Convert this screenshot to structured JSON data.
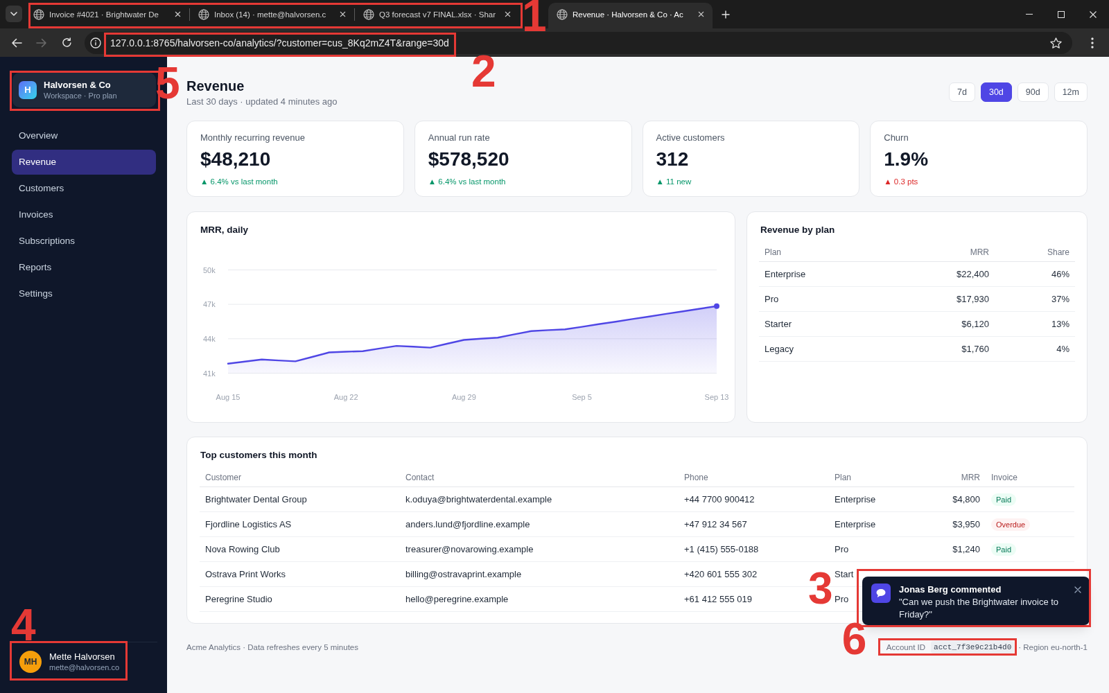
{
  "browser": {
    "tabs_callout": "1",
    "tabs": [
      {
        "title": "Invoice #4021 · Brightwater De",
        "selected": false,
        "in_callout": true
      },
      {
        "title": "Inbox (14) · mette@halvorsen.c",
        "selected": false,
        "in_callout": true
      },
      {
        "title": "Q3 forecast v7 FINAL.xlsx · Shar",
        "selected": false,
        "in_callout": true
      },
      {
        "title": "Revenue · Halvorsen & Co · Ac",
        "selected": true,
        "in_callout": false
      }
    ],
    "forward_disabled": true,
    "url": "127.0.0.1:8765/halvorsen-co/analytics/?customer=cus_8Kq2mZ4T&range=30d",
    "url_callout": "2"
  },
  "sidebar": {
    "workspace": {
      "initial": "H",
      "name": "Halvorsen & Co",
      "plan": "Workspace · Pro plan",
      "callout": "5"
    },
    "items": [
      {
        "label": "Overview",
        "selected": false
      },
      {
        "label": "Revenue",
        "selected": true
      },
      {
        "label": "Customers",
        "selected": false
      },
      {
        "label": "Invoices",
        "selected": false
      },
      {
        "label": "Subscriptions",
        "selected": false
      },
      {
        "label": "Reports",
        "selected": false
      },
      {
        "label": "Settings",
        "selected": false
      }
    ],
    "user": {
      "initials": "MH",
      "name": "Mette Halvorsen",
      "email": "mette@halvorsen.co",
      "callout": "4"
    }
  },
  "header": {
    "title": "Revenue",
    "subtitle": "Last 30 days · updated 4 minutes ago",
    "ranges": [
      {
        "label": "7d",
        "selected": false
      },
      {
        "label": "30d",
        "selected": true
      },
      {
        "label": "90d",
        "selected": false
      },
      {
        "label": "12m",
        "selected": false
      }
    ]
  },
  "kpis": [
    {
      "label": "Monthly recurring revenue",
      "value": "$48,210",
      "delta": "▲ 6.4% vs last month",
      "color": "#059669"
    },
    {
      "label": "Annual run rate",
      "value": "$578,520",
      "delta": "▲ 6.4% vs last month",
      "color": "#059669"
    },
    {
      "label": "Active customers",
      "value": "312",
      "delta": "▲ 11 new",
      "color": "#059669"
    },
    {
      "label": "Churn",
      "value": "1.9%",
      "delta": "▲ 0.3 pts",
      "color": "#dc2626"
    }
  ],
  "mrr_chart": {
    "chart_data": {
      "type": "area",
      "title": "MRR, daily",
      "grid": true,
      "categories": [
        "Aug 15",
        null,
        null,
        null,
        null,
        null,
        null,
        "Aug 22",
        null,
        null,
        null,
        null,
        null,
        null,
        "Aug 29",
        null,
        null,
        null,
        null,
        null,
        null,
        "Sep 5",
        null,
        null,
        null,
        null,
        null,
        null,
        null,
        "Sep 13"
      ],
      "series": [
        {
          "color": "#4f46e5",
          "values": [
            41830,
            42010,
            42190,
            42110,
            42030,
            42420,
            42810,
            42870,
            42920,
            43150,
            43380,
            43310,
            43230,
            43570,
            43900,
            44000,
            44100,
            44390,
            44670,
            44750,
            44820,
            45040,
            45270,
            45490,
            45720,
            45940,
            46170,
            46390,
            46620,
            46840
          ]
        }
      ],
      "ylim": [
        41000,
        50000
      ],
      "yticks": [
        {
          "value": 41000,
          "label": "41k"
        },
        {
          "value": 44000,
          "label": "44k"
        },
        {
          "value": 47000,
          "label": "47k"
        },
        {
          "value": 50000,
          "label": "50k"
        }
      ]
    }
  },
  "plans": {
    "title": "Revenue by plan",
    "columns": [
      "Plan",
      "MRR",
      "Share"
    ],
    "rows": [
      [
        "Enterprise",
        "$22,400",
        "46%"
      ],
      [
        "Pro",
        "$17,930",
        "37%"
      ],
      [
        "Starter",
        "$6,120",
        "13%"
      ],
      [
        "Legacy",
        "$1,760",
        "4%"
      ]
    ]
  },
  "customers": {
    "title": "Top customers this month",
    "columns": [
      "Customer",
      "Contact",
      "Phone",
      "Plan",
      "MRR",
      "Invoice"
    ],
    "rows": [
      {
        "customer": "Brightwater Dental Group",
        "contact": "k.oduya@brightwaterdental.example",
        "phone": "+44 7700 900412",
        "plan": "Enterprise",
        "mrr": "$4,800",
        "invoice": {
          "label": "Paid",
          "kind": "paid"
        }
      },
      {
        "customer": "Fjordline Logistics AS",
        "contact": "anders.lund@fjordline.example",
        "phone": "+47 912 34 567",
        "plan": "Enterprise",
        "mrr": "$3,950",
        "invoice": {
          "label": "Overdue",
          "kind": "overdue"
        }
      },
      {
        "customer": "Nova Rowing Club",
        "contact": "treasurer@novarowing.example",
        "phone": "+1 (415) 555-0188",
        "plan": "Pro",
        "mrr": "$1,240",
        "invoice": {
          "label": "Paid",
          "kind": "paid"
        }
      },
      {
        "customer": "Ostrava Print Works",
        "contact": "billing@ostravaprint.example",
        "phone": "+420 601 555 302",
        "plan": "Start"
      },
      {
        "customer": "Peregrine Studio",
        "contact": "hello@peregrine.example",
        "phone": "+61 412 555 019",
        "plan": "Pro"
      }
    ]
  },
  "toast": {
    "title": "Jonas Berg commented",
    "message": "\"Can we push the Brightwater invoice to Friday?\"",
    "callout": "3"
  },
  "footer": {
    "note": "Acme Analytics · Data refreshes every 5 minutes",
    "account_label": "Account ID",
    "account_id": "acct_7f3e9c21b4d0",
    "region": "· Region eu-north-1",
    "callout": "6"
  }
}
